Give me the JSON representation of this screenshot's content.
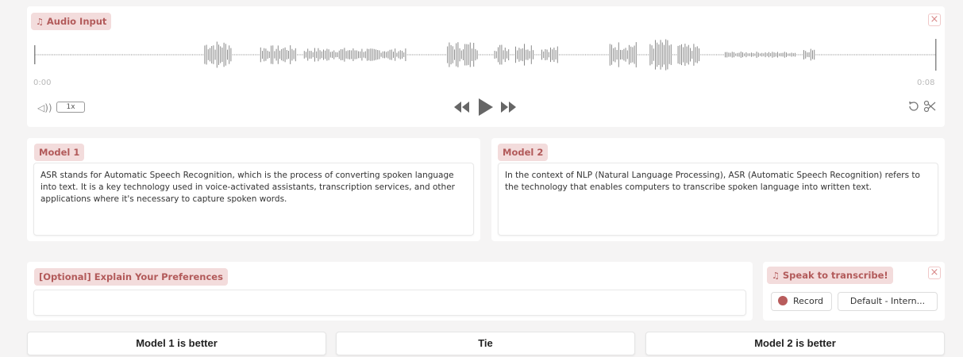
{
  "audio_input": {
    "label": "Audio Input",
    "note_icon": "music-note-icon",
    "close_symbol": "×",
    "time_start": "0:00",
    "time_end": "0:08",
    "speed": "1x",
    "volume_icon": "volume-icon",
    "rewind_icon": "rewind-icon",
    "play_icon": "play-icon",
    "forward_icon": "fast-forward-icon",
    "undo_icon": "undo-icon",
    "trim_icon": "scissors-icon"
  },
  "model1": {
    "label": "Model 1",
    "text": "ASR stands for Automatic Speech Recognition, which is the process of converting spoken language into text. It is a key technology used in voice-activated assistants, transcription services, and other applications where it's necessary to capture spoken words."
  },
  "model2": {
    "label": "Model 2",
    "text": "In the context of NLP (Natural Language Processing), ASR (Automatic Speech Recognition) refers to the technology that enables computers to transcribe spoken language into written text."
  },
  "preferences": {
    "label": "[Optional] Explain Your Preferences",
    "value": ""
  },
  "speak": {
    "label": "Speak to transcribe!",
    "close_symbol": "×",
    "record_label": "Record",
    "device": "Default - Intern..."
  },
  "vote": {
    "model1_better": "Model 1 is better",
    "tie": "Tie",
    "model2_better": "Model 2 is better"
  },
  "colors": {
    "accent": "#b25a5a",
    "tag_bg": "#f3dcdc",
    "record_dot": "#b85c5c",
    "waveform": "#8a8a8a"
  }
}
